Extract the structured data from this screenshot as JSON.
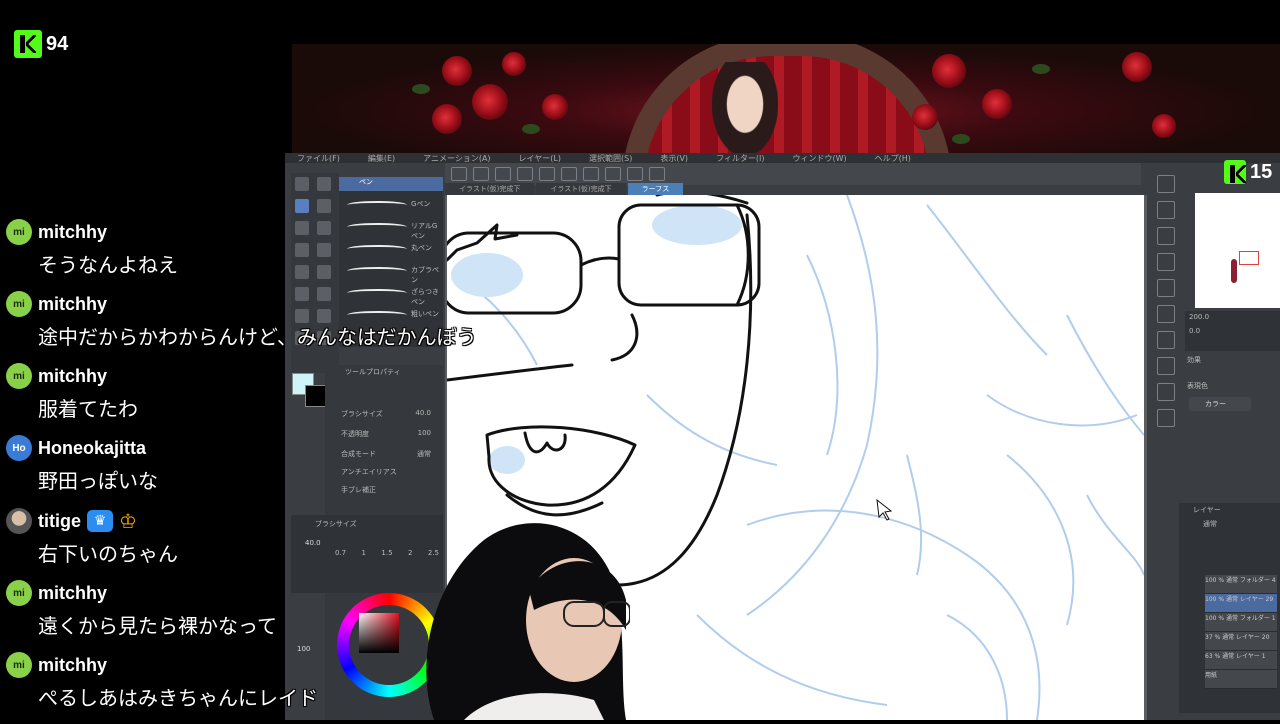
{
  "stream": {
    "viewer_count_left": "94",
    "viewer_count_right": "15",
    "brand_color": "#53fc18"
  },
  "chat": [
    {
      "avatar": "mi",
      "avatar_color": "#8ad14a",
      "user": "mitchhy",
      "text": "そうなんよねえ"
    },
    {
      "avatar": "mi",
      "avatar_color": "#8ad14a",
      "user": "mitchhy",
      "text": "途中だからかわからんけど、みんなはだかんぼう"
    },
    {
      "avatar": "mi",
      "avatar_color": "#8ad14a",
      "user": "mitchhy",
      "text": "服着てたわ"
    },
    {
      "avatar": "Ho",
      "avatar_color": "#3a7bd5",
      "user": "Honeokajitta",
      "text": "野田っぽいな"
    },
    {
      "avatar": "",
      "avatar_color": "#777777",
      "user": "titige",
      "text": "右下いのちゃん",
      "badges": [
        "crown-badge",
        "king-badge"
      ]
    },
    {
      "avatar": "mi",
      "avatar_color": "#8ad14a",
      "user": "mitchhy",
      "text": "遠くから見たら裸かなって"
    },
    {
      "avatar": "mi",
      "avatar_color": "#8ad14a",
      "user": "mitchhy",
      "text": "ぺるしあはみきちゃんにレイド"
    }
  ],
  "editor": {
    "menu": [
      "ファイル(F)",
      "編集(E)",
      "アニメーション(A)",
      "レイヤー(L)",
      "選択範囲(S)",
      "表示(V)",
      "フィルター(I)",
      "ウィンドウ(W)",
      "ヘルプ(H)"
    ],
    "tabs": [
      "イラスト(仮)完成下",
      "イラスト(仮)完成下",
      "ラーフス"
    ],
    "brush_panel_title": "ペン",
    "brushes": [
      "Gペン",
      "リアルGペン",
      "丸ペン",
      "カブラペン",
      "ざらつきペン",
      "粗いペン"
    ],
    "tool_property_title": "ツールプロパティ",
    "brush_size_label": "ブラシサイズ",
    "brush_size_value": "40.0",
    "opacity_label": "不透明度",
    "opacity_value": "100",
    "blend_label": "合成モード",
    "blend_value": "通常",
    "antialias_label": "アンチエイリアス",
    "stabilize_label": "手ブレ補正",
    "brush_size_panel_title": "ブラシサイズ",
    "size_presets": [
      "0.7",
      "1",
      "1.5",
      "2",
      "2.5"
    ],
    "size_side_value": "40.0",
    "zoom_value": "100",
    "color_label": "表現色",
    "color_value": "カラー",
    "effect_label": "効果",
    "layer_panel_title": "レイヤー",
    "blend_mode_short": "通常",
    "layers": [
      {
        "name": "100 % 通常 フォルダー 4",
        "selected": false
      },
      {
        "name": "100 % 通常 レイヤー 29",
        "selected": true
      },
      {
        "name": "100 % 通常 フォルダー 1",
        "selected": false
      },
      {
        "name": "37 % 通常 レイヤー 20",
        "selected": false
      },
      {
        "name": "63 % 通常 レイヤー 1",
        "selected": false
      },
      {
        "name": "用紙",
        "selected": false
      }
    ],
    "nav_zoom": "200.0",
    "nav_angle": "0.0"
  }
}
